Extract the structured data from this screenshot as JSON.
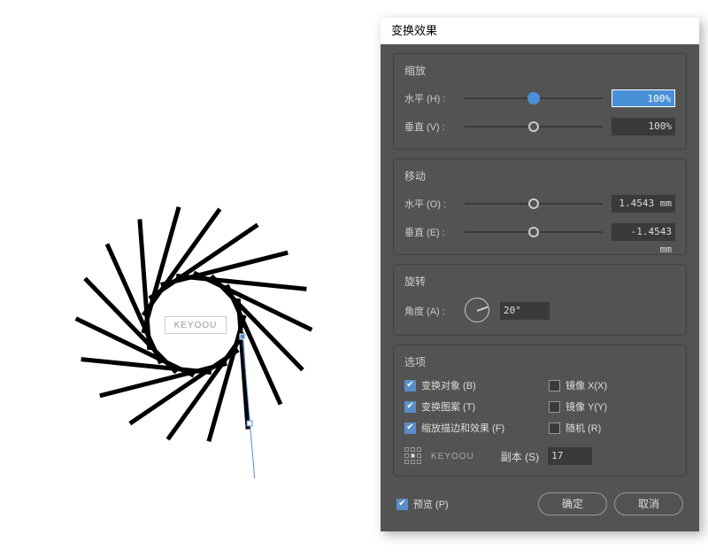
{
  "canvas": {
    "badge": "KEYOOU"
  },
  "dialog": {
    "title": "变换效果",
    "scale": {
      "title": "缩放",
      "horizontal_label": "水平 (H) :",
      "horizontal_value": "100%",
      "vertical_label": "垂直 (V) :",
      "vertical_value": "100%"
    },
    "move": {
      "title": "移动",
      "horizontal_label": "水平 (O) :",
      "horizontal_value": "1.4543 mm",
      "vertical_label": "垂直 (E) :",
      "vertical_value": "-1.4543 mm"
    },
    "rotate": {
      "title": "旋转",
      "angle_label": "角度 (A) :",
      "angle_value": "20°"
    },
    "options": {
      "title": "选项",
      "transform_object": "变换对象 (B)",
      "mirror_x": "镜像 X(X)",
      "transform_pattern": "变换图案 (T)",
      "mirror_y": "镜像 Y(Y)",
      "scale_strokes": "缩放描边和效果 (F)",
      "random": "随机 (R)",
      "keyoou": "KEYOOU",
      "copies_label": "副本 (S)",
      "copies_value": "17"
    },
    "preview_label": "预览 (P)",
    "ok": "确定",
    "cancel": "取消"
  }
}
